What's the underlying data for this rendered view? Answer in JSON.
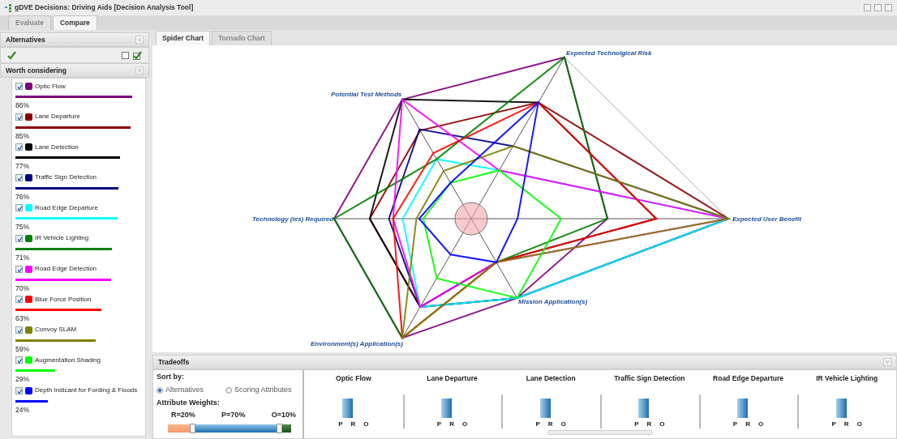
{
  "window": {
    "title": "gDVE Decisions: Driving Aids [Decision Analysis Tool]"
  },
  "main_tabs": [
    {
      "label": "Evaluate",
      "selected": false
    },
    {
      "label": "Compare",
      "selected": true
    }
  ],
  "sidebar": {
    "title": "Alternatives",
    "group_title": "Worth considering",
    "items": [
      {
        "name": "Optic Flow",
        "checked": true,
        "color": "#800080",
        "percent": "86%"
      },
      {
        "name": "Lane Departure",
        "checked": true,
        "color": "#8b0000",
        "percent": "85%"
      },
      {
        "name": "Lane Detection",
        "checked": true,
        "color": "#000000",
        "percent": "77%"
      },
      {
        "name": "Traffic Sign Detection",
        "checked": true,
        "color": "#000080",
        "percent": "76%"
      },
      {
        "name": "Road Edge Departure",
        "checked": true,
        "color": "#00ffff",
        "percent": "75%"
      },
      {
        "name": "IR Vehicle Lighting",
        "checked": true,
        "color": "#008000",
        "percent": "71%"
      },
      {
        "name": "Road Edge Detection",
        "checked": true,
        "color": "#ff00ff",
        "percent": "70%"
      },
      {
        "name": "Blue Force Position",
        "checked": true,
        "color": "#ff0000",
        "percent": "63%"
      },
      {
        "name": "Convoy SLAM",
        "checked": true,
        "color": "#808000",
        "percent": "59%"
      },
      {
        "name": "Augmentation Shading",
        "checked": true,
        "color": "#00ff00",
        "percent": "29%"
      },
      {
        "name": "Depth Indicant for Fording & Floods",
        "checked": true,
        "color": "#0000ff",
        "percent": "24%"
      }
    ]
  },
  "chart_tabs": [
    {
      "label": "Spider Chart",
      "selected": true
    },
    {
      "label": "Tornado Chart",
      "selected": false
    }
  ],
  "spider_axes": [
    "Expected User Benefit",
    "Expected Technolgical Risk",
    "Potential Test Methods",
    "Technology (ies) Required",
    "Environment(s) Application(s)",
    "Mission Application(s)"
  ],
  "tradeoffs": {
    "title": "Tradeoffs",
    "sort_label": "Sort by:",
    "sort_options": [
      {
        "label": "Alternatives",
        "selected": true
      },
      {
        "label": "Scoring Attributes",
        "selected": false
      }
    ],
    "weights_label": "Attribute Weights:",
    "weights": [
      "R=20%",
      "P=70%",
      "O=10%"
    ],
    "thumbs": [
      {
        "level": 0.2
      },
      {
        "level": 0.9
      }
    ],
    "columns": [
      {
        "name": "Optic Flow",
        "letters": [
          "P",
          "R",
          "O"
        ]
      },
      {
        "name": "Lane Departure",
        "letters": [
          "P",
          "R",
          "O"
        ]
      },
      {
        "name": "Lane Detection",
        "letters": [
          "P",
          "R",
          "O"
        ]
      },
      {
        "name": "Traffic Sign Detection",
        "letters": [
          "P",
          "R",
          "O"
        ]
      },
      {
        "name": "Road Edge Departure",
        "letters": [
          "P",
          "R",
          "O"
        ]
      },
      {
        "name": "IR Vehicle Lighting",
        "letters": [
          "P",
          "R",
          "O"
        ]
      }
    ]
  }
}
